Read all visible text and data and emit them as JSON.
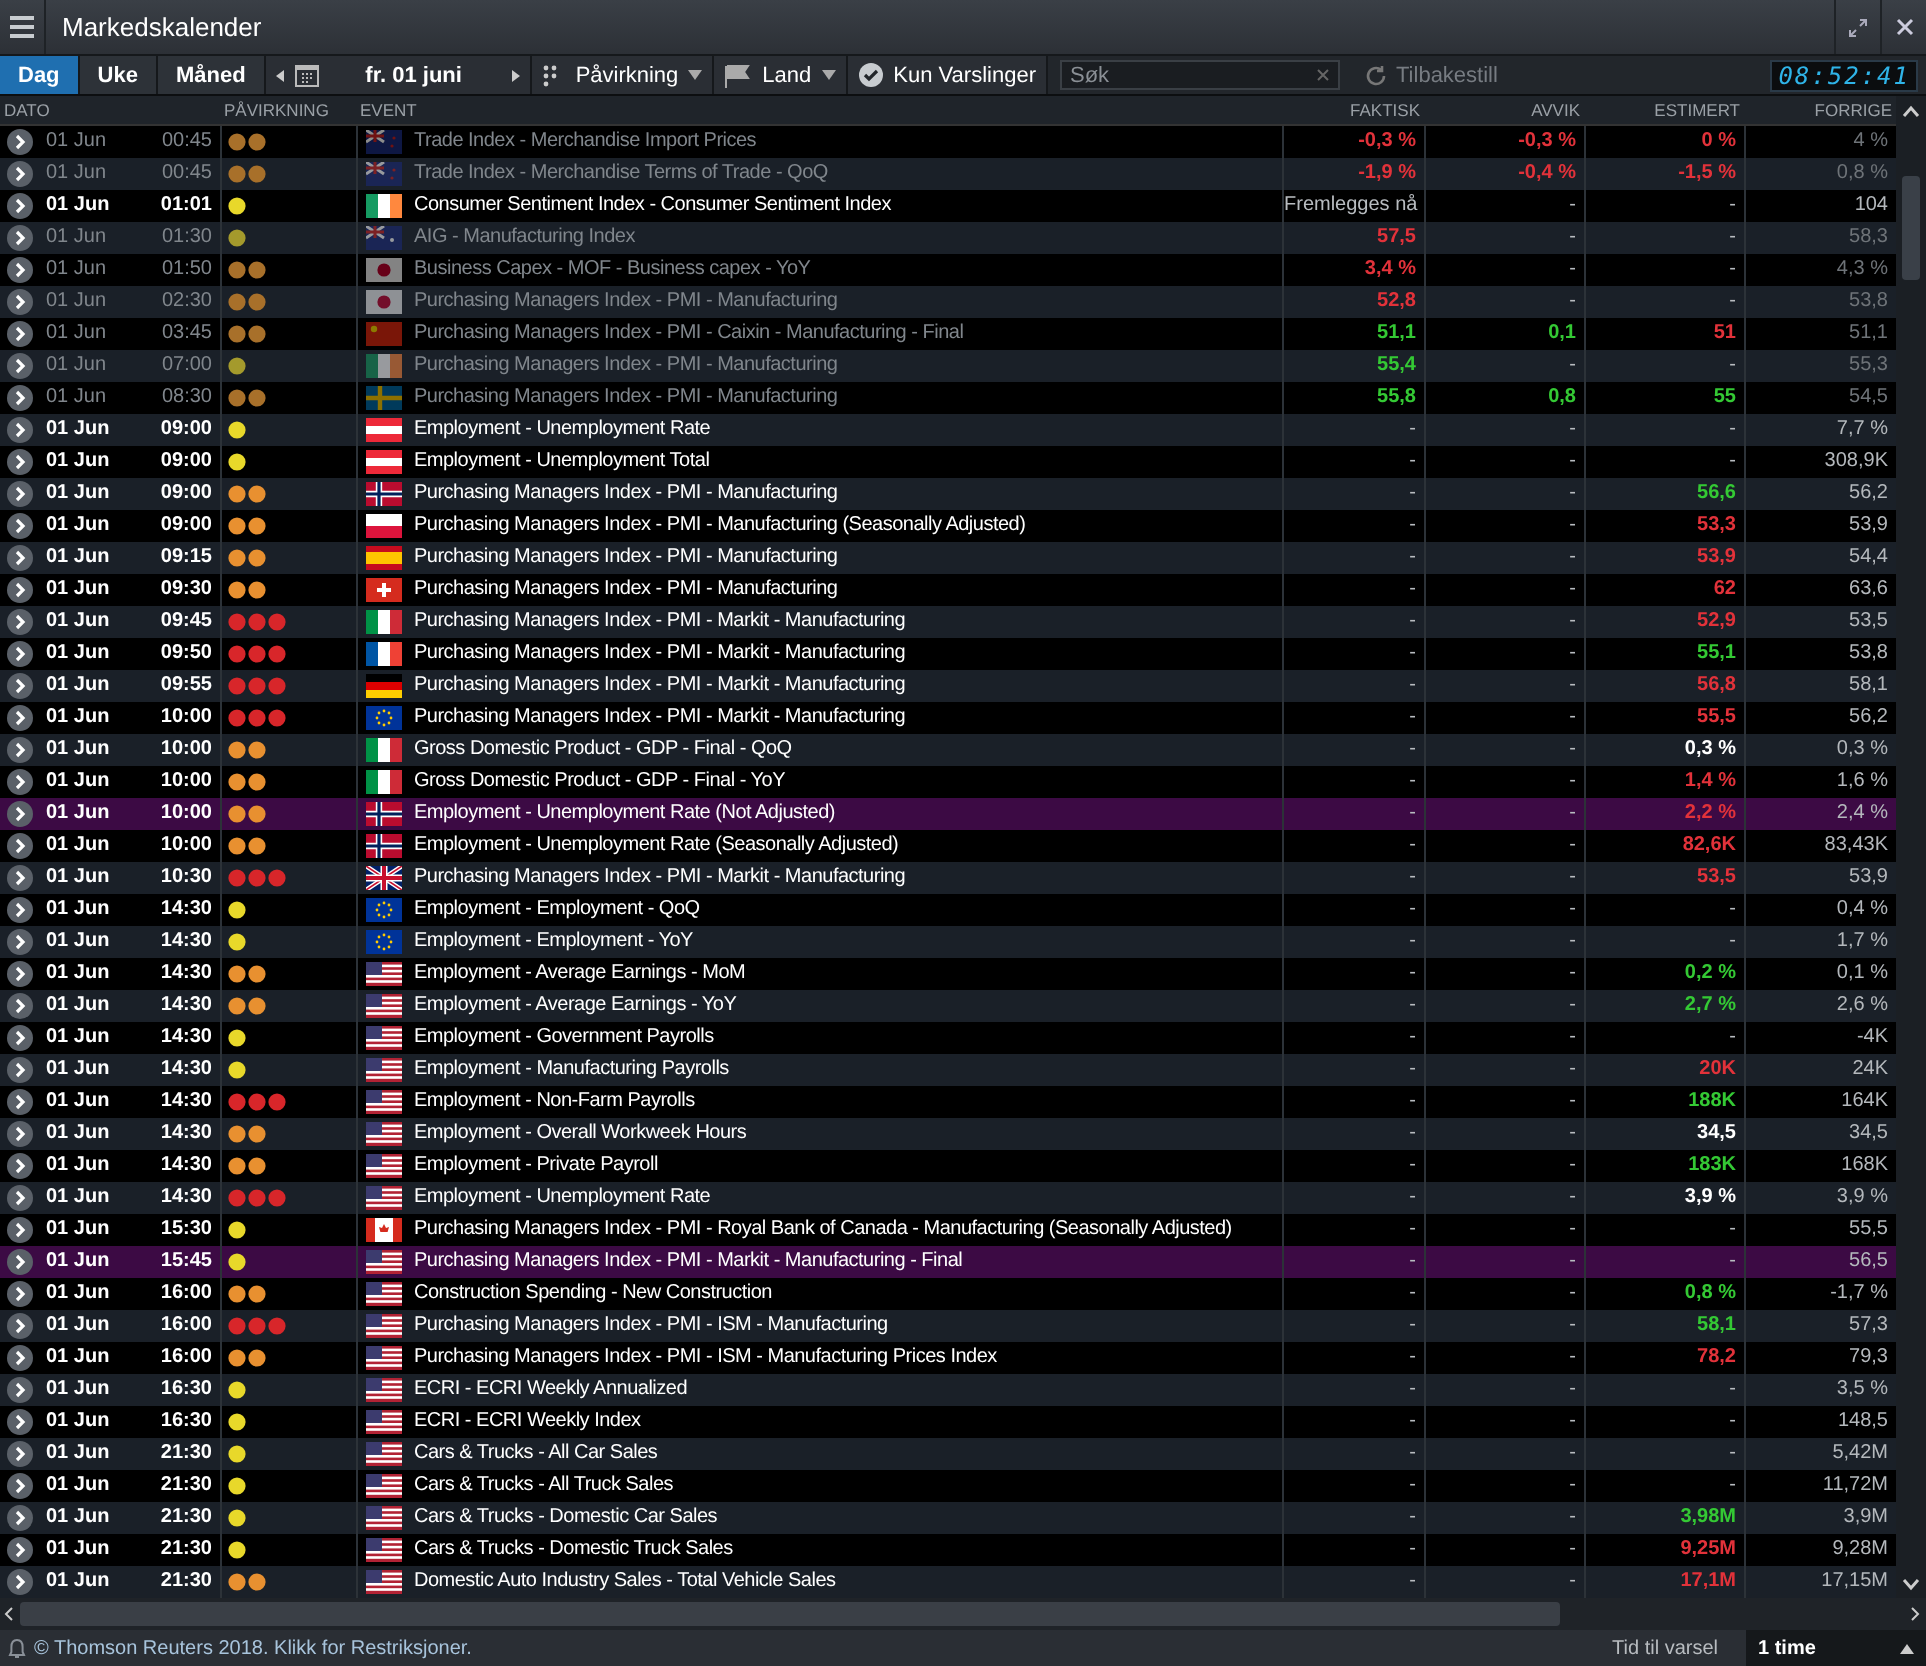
{
  "window": {
    "title": "Markedskalender"
  },
  "toolbar": {
    "tabs": [
      {
        "label": "Dag",
        "selected": true
      },
      {
        "label": "Uke",
        "selected": false
      },
      {
        "label": "Måned",
        "selected": false
      }
    ],
    "date": "fr. 01 juni",
    "filters": [
      {
        "kind": "impact",
        "label": "Påvirkning"
      },
      {
        "kind": "country",
        "label": "Land"
      },
      {
        "kind": "alerts",
        "label": "Kun Varslinger"
      }
    ],
    "search": {
      "placeholder": "Søk"
    },
    "reset": {
      "label": "Tilbakestill",
      "disabled": true
    },
    "clock": "08:52:41"
  },
  "table": {
    "columns": [
      "DATO",
      "PÅVIRKNING",
      "EVENT",
      "FAKTISK",
      "AVVIK",
      "ESTIMERT",
      "FORRIGE"
    ],
    "rows": [
      {
        "date": "01 Jun",
        "time": "00:45",
        "impact": {
          "kind": "medium"
        },
        "flag": {
          "kind": "nz"
        },
        "event": "Trade Index - Merchandise Import Prices",
        "released": true,
        "highlighted": false,
        "actual": {
          "text": "-0,3 %",
          "kind": "negative"
        },
        "deviation": {
          "text": "-0,3 %",
          "kind": "negative"
        },
        "estimate": {
          "text": "0 %",
          "kind": "negative"
        },
        "previous": "4 %"
      },
      {
        "date": "01 Jun",
        "time": "00:45",
        "impact": {
          "kind": "medium"
        },
        "flag": {
          "kind": "nz"
        },
        "event": "Trade Index - Merchandise Terms of Trade - QoQ",
        "released": true,
        "highlighted": false,
        "actual": {
          "text": "-1,9 %",
          "kind": "negative"
        },
        "deviation": {
          "text": "-0,4 %",
          "kind": "negative"
        },
        "estimate": {
          "text": "-1,5 %",
          "kind": "negative"
        },
        "previous": "0,8 %"
      },
      {
        "date": "01 Jun",
        "time": "01:01",
        "impact": {
          "kind": "low"
        },
        "flag": {
          "kind": "ie"
        },
        "event": "Consumer Sentiment Index - Consumer Sentiment Index",
        "released": false,
        "highlighted": false,
        "actual": {
          "text": "Fremlegges nå",
          "kind": "plain"
        },
        "deviation": {
          "text": "-",
          "kind": "plain"
        },
        "estimate": {
          "text": "-",
          "kind": "plain"
        },
        "previous": "104"
      },
      {
        "date": "01 Jun",
        "time": "01:30",
        "impact": {
          "kind": "low"
        },
        "flag": {
          "kind": "au"
        },
        "event": "AIG - Manufacturing Index",
        "released": true,
        "highlighted": false,
        "actual": {
          "text": "57,5",
          "kind": "negative"
        },
        "deviation": {
          "text": "-",
          "kind": "plain"
        },
        "estimate": {
          "text": "-",
          "kind": "plain"
        },
        "previous": "58,3"
      },
      {
        "date": "01 Jun",
        "time": "01:50",
        "impact": {
          "kind": "medium"
        },
        "flag": {
          "kind": "jp"
        },
        "event": "Business Capex - MOF - Business capex - YoY",
        "released": true,
        "highlighted": false,
        "actual": {
          "text": "3,4 %",
          "kind": "negative"
        },
        "deviation": {
          "text": "-",
          "kind": "plain"
        },
        "estimate": {
          "text": "-",
          "kind": "plain"
        },
        "previous": "4,3 %"
      },
      {
        "date": "01 Jun",
        "time": "02:30",
        "impact": {
          "kind": "medium"
        },
        "flag": {
          "kind": "jp"
        },
        "event": "Purchasing Managers Index - PMI - Manufacturing",
        "released": true,
        "highlighted": false,
        "actual": {
          "text": "52,8",
          "kind": "negative"
        },
        "deviation": {
          "text": "-",
          "kind": "plain"
        },
        "estimate": {
          "text": "-",
          "kind": "plain"
        },
        "previous": "53,8"
      },
      {
        "date": "01 Jun",
        "time": "03:45",
        "impact": {
          "kind": "medium"
        },
        "flag": {
          "kind": "cn"
        },
        "event": "Purchasing Managers Index - PMI - Caixin - Manufacturing - Final",
        "released": true,
        "highlighted": false,
        "actual": {
          "text": "51,1",
          "kind": "positive"
        },
        "deviation": {
          "text": "0,1",
          "kind": "positive"
        },
        "estimate": {
          "text": "51",
          "kind": "negative"
        },
        "previous": "51,1"
      },
      {
        "date": "01 Jun",
        "time": "07:00",
        "impact": {
          "kind": "low"
        },
        "flag": {
          "kind": "ie"
        },
        "event": "Purchasing Managers Index - PMI - Manufacturing",
        "released": true,
        "highlighted": false,
        "actual": {
          "text": "55,4",
          "kind": "positive"
        },
        "deviation": {
          "text": "-",
          "kind": "plain"
        },
        "estimate": {
          "text": "-",
          "kind": "plain"
        },
        "previous": "55,3"
      },
      {
        "date": "01 Jun",
        "time": "08:30",
        "impact": {
          "kind": "medium"
        },
        "flag": {
          "kind": "se"
        },
        "event": "Purchasing Managers Index - PMI - Manufacturing",
        "released": true,
        "highlighted": false,
        "actual": {
          "text": "55,8",
          "kind": "positive"
        },
        "deviation": {
          "text": "0,8",
          "kind": "positive"
        },
        "estimate": {
          "text": "55",
          "kind": "positive"
        },
        "previous": "54,5"
      },
      {
        "date": "01 Jun",
        "time": "09:00",
        "impact": {
          "kind": "low"
        },
        "flag": {
          "kind": "at"
        },
        "event": "Employment - Unemployment Rate",
        "released": false,
        "highlighted": false,
        "actual": {
          "text": "-",
          "kind": "plain"
        },
        "deviation": {
          "text": "-",
          "kind": "plain"
        },
        "estimate": {
          "text": "-",
          "kind": "plain"
        },
        "previous": "7,7 %"
      },
      {
        "date": "01 Jun",
        "time": "09:00",
        "impact": {
          "kind": "low"
        },
        "flag": {
          "kind": "at"
        },
        "event": "Employment - Unemployment Total",
        "released": false,
        "highlighted": false,
        "actual": {
          "text": "-",
          "kind": "plain"
        },
        "deviation": {
          "text": "-",
          "kind": "plain"
        },
        "estimate": {
          "text": "-",
          "kind": "plain"
        },
        "previous": "308,9K"
      },
      {
        "date": "01 Jun",
        "time": "09:00",
        "impact": {
          "kind": "medium"
        },
        "flag": {
          "kind": "no"
        },
        "event": "Purchasing Managers Index - PMI - Manufacturing",
        "released": false,
        "highlighted": false,
        "actual": {
          "text": "-",
          "kind": "plain"
        },
        "deviation": {
          "text": "-",
          "kind": "plain"
        },
        "estimate": {
          "text": "56,6",
          "kind": "positive"
        },
        "previous": "56,2"
      },
      {
        "date": "01 Jun",
        "time": "09:00",
        "impact": {
          "kind": "medium"
        },
        "flag": {
          "kind": "pl"
        },
        "event": "Purchasing Managers Index - PMI - Manufacturing (Seasonally Adjusted)",
        "released": false,
        "highlighted": false,
        "actual": {
          "text": "-",
          "kind": "plain"
        },
        "deviation": {
          "text": "-",
          "kind": "plain"
        },
        "estimate": {
          "text": "53,3",
          "kind": "negative"
        },
        "previous": "53,9"
      },
      {
        "date": "01 Jun",
        "time": "09:15",
        "impact": {
          "kind": "medium"
        },
        "flag": {
          "kind": "es"
        },
        "event": "Purchasing Managers Index - PMI - Manufacturing",
        "released": false,
        "highlighted": false,
        "actual": {
          "text": "-",
          "kind": "plain"
        },
        "deviation": {
          "text": "-",
          "kind": "plain"
        },
        "estimate": {
          "text": "53,9",
          "kind": "negative"
        },
        "previous": "54,4"
      },
      {
        "date": "01 Jun",
        "time": "09:30",
        "impact": {
          "kind": "medium"
        },
        "flag": {
          "kind": "ch"
        },
        "event": "Purchasing Managers Index - PMI - Manufacturing",
        "released": false,
        "highlighted": false,
        "actual": {
          "text": "-",
          "kind": "plain"
        },
        "deviation": {
          "text": "-",
          "kind": "plain"
        },
        "estimate": {
          "text": "62",
          "kind": "negative"
        },
        "previous": "63,6"
      },
      {
        "date": "01 Jun",
        "time": "09:45",
        "impact": {
          "kind": "high"
        },
        "flag": {
          "kind": "it"
        },
        "event": "Purchasing Managers Index - PMI - Markit - Manufacturing",
        "released": false,
        "highlighted": false,
        "actual": {
          "text": "-",
          "kind": "plain"
        },
        "deviation": {
          "text": "-",
          "kind": "plain"
        },
        "estimate": {
          "text": "52,9",
          "kind": "negative"
        },
        "previous": "53,5"
      },
      {
        "date": "01 Jun",
        "time": "09:50",
        "impact": {
          "kind": "high"
        },
        "flag": {
          "kind": "fr"
        },
        "event": "Purchasing Managers Index - PMI - Markit - Manufacturing",
        "released": false,
        "highlighted": false,
        "actual": {
          "text": "-",
          "kind": "plain"
        },
        "deviation": {
          "text": "-",
          "kind": "plain"
        },
        "estimate": {
          "text": "55,1",
          "kind": "positive"
        },
        "previous": "53,8"
      },
      {
        "date": "01 Jun",
        "time": "09:55",
        "impact": {
          "kind": "high"
        },
        "flag": {
          "kind": "de"
        },
        "event": "Purchasing Managers Index - PMI - Markit - Manufacturing",
        "released": false,
        "highlighted": false,
        "actual": {
          "text": "-",
          "kind": "plain"
        },
        "deviation": {
          "text": "-",
          "kind": "plain"
        },
        "estimate": {
          "text": "56,8",
          "kind": "negative"
        },
        "previous": "58,1"
      },
      {
        "date": "01 Jun",
        "time": "10:00",
        "impact": {
          "kind": "high"
        },
        "flag": {
          "kind": "eu"
        },
        "event": "Purchasing Managers Index - PMI - Markit - Manufacturing",
        "released": false,
        "highlighted": false,
        "actual": {
          "text": "-",
          "kind": "plain"
        },
        "deviation": {
          "text": "-",
          "kind": "plain"
        },
        "estimate": {
          "text": "55,5",
          "kind": "negative"
        },
        "previous": "56,2"
      },
      {
        "date": "01 Jun",
        "time": "10:00",
        "impact": {
          "kind": "medium"
        },
        "flag": {
          "kind": "it"
        },
        "event": "Gross Domestic Product - GDP - Final - QoQ",
        "released": false,
        "highlighted": false,
        "actual": {
          "text": "-",
          "kind": "plain"
        },
        "deviation": {
          "text": "-",
          "kind": "plain"
        },
        "estimate": {
          "text": "0,3 %",
          "kind": "neutral"
        },
        "previous": "0,3 %"
      },
      {
        "date": "01 Jun",
        "time": "10:00",
        "impact": {
          "kind": "medium"
        },
        "flag": {
          "kind": "it"
        },
        "event": "Gross Domestic Product - GDP - Final - YoY",
        "released": false,
        "highlighted": false,
        "actual": {
          "text": "-",
          "kind": "plain"
        },
        "deviation": {
          "text": "-",
          "kind": "plain"
        },
        "estimate": {
          "text": "1,4 %",
          "kind": "negative"
        },
        "previous": "1,6 %"
      },
      {
        "date": "01 Jun",
        "time": "10:00",
        "impact": {
          "kind": "medium"
        },
        "flag": {
          "kind": "no"
        },
        "event": "Employment - Unemployment Rate (Not Adjusted)",
        "released": false,
        "highlighted": true,
        "actual": {
          "text": "-",
          "kind": "plain"
        },
        "deviation": {
          "text": "-",
          "kind": "plain"
        },
        "estimate": {
          "text": "2,2 %",
          "kind": "negative"
        },
        "previous": "2,4 %"
      },
      {
        "date": "01 Jun",
        "time": "10:00",
        "impact": {
          "kind": "medium"
        },
        "flag": {
          "kind": "no"
        },
        "event": "Employment - Unemployment Rate (Seasonally Adjusted)",
        "released": false,
        "highlighted": false,
        "actual": {
          "text": "-",
          "kind": "plain"
        },
        "deviation": {
          "text": "-",
          "kind": "plain"
        },
        "estimate": {
          "text": "82,6K",
          "kind": "negative"
        },
        "previous": "83,43K"
      },
      {
        "date": "01 Jun",
        "time": "10:30",
        "impact": {
          "kind": "high"
        },
        "flag": {
          "kind": "gb"
        },
        "event": "Purchasing Managers Index - PMI - Markit - Manufacturing",
        "released": false,
        "highlighted": false,
        "actual": {
          "text": "-",
          "kind": "plain"
        },
        "deviation": {
          "text": "-",
          "kind": "plain"
        },
        "estimate": {
          "text": "53,5",
          "kind": "negative"
        },
        "previous": "53,9"
      },
      {
        "date": "01 Jun",
        "time": "14:30",
        "impact": {
          "kind": "low"
        },
        "flag": {
          "kind": "eu"
        },
        "event": "Employment - Employment - QoQ",
        "released": false,
        "highlighted": false,
        "actual": {
          "text": "-",
          "kind": "plain"
        },
        "deviation": {
          "text": "-",
          "kind": "plain"
        },
        "estimate": {
          "text": "-",
          "kind": "plain"
        },
        "previous": "0,4 %"
      },
      {
        "date": "01 Jun",
        "time": "14:30",
        "impact": {
          "kind": "low"
        },
        "flag": {
          "kind": "eu"
        },
        "event": "Employment - Employment - YoY",
        "released": false,
        "highlighted": false,
        "actual": {
          "text": "-",
          "kind": "plain"
        },
        "deviation": {
          "text": "-",
          "kind": "plain"
        },
        "estimate": {
          "text": "-",
          "kind": "plain"
        },
        "previous": "1,7 %"
      },
      {
        "date": "01 Jun",
        "time": "14:30",
        "impact": {
          "kind": "medium"
        },
        "flag": {
          "kind": "us"
        },
        "event": "Employment - Average Earnings - MoM",
        "released": false,
        "highlighted": false,
        "actual": {
          "text": "-",
          "kind": "plain"
        },
        "deviation": {
          "text": "-",
          "kind": "plain"
        },
        "estimate": {
          "text": "0,2 %",
          "kind": "positive"
        },
        "previous": "0,1 %"
      },
      {
        "date": "01 Jun",
        "time": "14:30",
        "impact": {
          "kind": "medium"
        },
        "flag": {
          "kind": "us"
        },
        "event": "Employment - Average Earnings - YoY",
        "released": false,
        "highlighted": false,
        "actual": {
          "text": "-",
          "kind": "plain"
        },
        "deviation": {
          "text": "-",
          "kind": "plain"
        },
        "estimate": {
          "text": "2,7 %",
          "kind": "positive"
        },
        "previous": "2,6 %"
      },
      {
        "date": "01 Jun",
        "time": "14:30",
        "impact": {
          "kind": "low"
        },
        "flag": {
          "kind": "us"
        },
        "event": "Employment - Government Payrolls",
        "released": false,
        "highlighted": false,
        "actual": {
          "text": "-",
          "kind": "plain"
        },
        "deviation": {
          "text": "-",
          "kind": "plain"
        },
        "estimate": {
          "text": "-",
          "kind": "plain"
        },
        "previous": "-4K"
      },
      {
        "date": "01 Jun",
        "time": "14:30",
        "impact": {
          "kind": "low"
        },
        "flag": {
          "kind": "us"
        },
        "event": "Employment - Manufacturing Payrolls",
        "released": false,
        "highlighted": false,
        "actual": {
          "text": "-",
          "kind": "plain"
        },
        "deviation": {
          "text": "-",
          "kind": "plain"
        },
        "estimate": {
          "text": "20K",
          "kind": "negative"
        },
        "previous": "24K"
      },
      {
        "date": "01 Jun",
        "time": "14:30",
        "impact": {
          "kind": "high"
        },
        "flag": {
          "kind": "us"
        },
        "event": "Employment - Non-Farm Payrolls",
        "released": false,
        "highlighted": false,
        "actual": {
          "text": "-",
          "kind": "plain"
        },
        "deviation": {
          "text": "-",
          "kind": "plain"
        },
        "estimate": {
          "text": "188K",
          "kind": "positive"
        },
        "previous": "164K"
      },
      {
        "date": "01 Jun",
        "time": "14:30",
        "impact": {
          "kind": "medium"
        },
        "flag": {
          "kind": "us"
        },
        "event": "Employment - Overall Workweek Hours",
        "released": false,
        "highlighted": false,
        "actual": {
          "text": "-",
          "kind": "plain"
        },
        "deviation": {
          "text": "-",
          "kind": "plain"
        },
        "estimate": {
          "text": "34,5",
          "kind": "neutral"
        },
        "previous": "34,5"
      },
      {
        "date": "01 Jun",
        "time": "14:30",
        "impact": {
          "kind": "medium"
        },
        "flag": {
          "kind": "us"
        },
        "event": "Employment - Private Payroll",
        "released": false,
        "highlighted": false,
        "actual": {
          "text": "-",
          "kind": "plain"
        },
        "deviation": {
          "text": "-",
          "kind": "plain"
        },
        "estimate": {
          "text": "183K",
          "kind": "positive"
        },
        "previous": "168K"
      },
      {
        "date": "01 Jun",
        "time": "14:30",
        "impact": {
          "kind": "high"
        },
        "flag": {
          "kind": "us"
        },
        "event": "Employment - Unemployment Rate",
        "released": false,
        "highlighted": false,
        "actual": {
          "text": "-",
          "kind": "plain"
        },
        "deviation": {
          "text": "-",
          "kind": "plain"
        },
        "estimate": {
          "text": "3,9 %",
          "kind": "neutral"
        },
        "previous": "3,9 %"
      },
      {
        "date": "01 Jun",
        "time": "15:30",
        "impact": {
          "kind": "low"
        },
        "flag": {
          "kind": "ca"
        },
        "event": "Purchasing Managers Index - PMI - Royal Bank of Canada - Manufacturing (Seasonally Adjusted)",
        "released": false,
        "highlighted": false,
        "actual": {
          "text": "-",
          "kind": "plain"
        },
        "deviation": {
          "text": "-",
          "kind": "plain"
        },
        "estimate": {
          "text": "-",
          "kind": "plain"
        },
        "previous": "55,5"
      },
      {
        "date": "01 Jun",
        "time": "15:45",
        "impact": {
          "kind": "low"
        },
        "flag": {
          "kind": "us"
        },
        "event": "Purchasing Managers Index - PMI - Markit - Manufacturing - Final",
        "released": false,
        "highlighted": true,
        "actual": {
          "text": "-",
          "kind": "plain"
        },
        "deviation": {
          "text": "-",
          "kind": "plain"
        },
        "estimate": {
          "text": "-",
          "kind": "plain"
        },
        "previous": "56,5"
      },
      {
        "date": "01 Jun",
        "time": "16:00",
        "impact": {
          "kind": "medium"
        },
        "flag": {
          "kind": "us"
        },
        "event": "Construction Spending - New Construction",
        "released": false,
        "highlighted": false,
        "actual": {
          "text": "-",
          "kind": "plain"
        },
        "deviation": {
          "text": "-",
          "kind": "plain"
        },
        "estimate": {
          "text": "0,8 %",
          "kind": "positive"
        },
        "previous": "-1,7 %"
      },
      {
        "date": "01 Jun",
        "time": "16:00",
        "impact": {
          "kind": "high"
        },
        "flag": {
          "kind": "us"
        },
        "event": "Purchasing Managers Index - PMI - ISM - Manufacturing",
        "released": false,
        "highlighted": false,
        "actual": {
          "text": "-",
          "kind": "plain"
        },
        "deviation": {
          "text": "-",
          "kind": "plain"
        },
        "estimate": {
          "text": "58,1",
          "kind": "positive"
        },
        "previous": "57,3"
      },
      {
        "date": "01 Jun",
        "time": "16:00",
        "impact": {
          "kind": "medium"
        },
        "flag": {
          "kind": "us"
        },
        "event": "Purchasing Managers Index - PMI - ISM - Manufacturing Prices Index",
        "released": false,
        "highlighted": false,
        "actual": {
          "text": "-",
          "kind": "plain"
        },
        "deviation": {
          "text": "-",
          "kind": "plain"
        },
        "estimate": {
          "text": "78,2",
          "kind": "negative"
        },
        "previous": "79,3"
      },
      {
        "date": "01 Jun",
        "time": "16:30",
        "impact": {
          "kind": "low"
        },
        "flag": {
          "kind": "us"
        },
        "event": "ECRI - ECRI Weekly Annualized",
        "released": false,
        "highlighted": false,
        "actual": {
          "text": "-",
          "kind": "plain"
        },
        "deviation": {
          "text": "-",
          "kind": "plain"
        },
        "estimate": {
          "text": "-",
          "kind": "plain"
        },
        "previous": "3,5 %"
      },
      {
        "date": "01 Jun",
        "time": "16:30",
        "impact": {
          "kind": "low"
        },
        "flag": {
          "kind": "us"
        },
        "event": "ECRI - ECRI Weekly Index",
        "released": false,
        "highlighted": false,
        "actual": {
          "text": "-",
          "kind": "plain"
        },
        "deviation": {
          "text": "-",
          "kind": "plain"
        },
        "estimate": {
          "text": "-",
          "kind": "plain"
        },
        "previous": "148,5"
      },
      {
        "date": "01 Jun",
        "time": "21:30",
        "impact": {
          "kind": "low"
        },
        "flag": {
          "kind": "us"
        },
        "event": "Cars & Trucks - All Car Sales",
        "released": false,
        "highlighted": false,
        "actual": {
          "text": "-",
          "kind": "plain"
        },
        "deviation": {
          "text": "-",
          "kind": "plain"
        },
        "estimate": {
          "text": "-",
          "kind": "plain"
        },
        "previous": "5,42M"
      },
      {
        "date": "01 Jun",
        "time": "21:30",
        "impact": {
          "kind": "low"
        },
        "flag": {
          "kind": "us"
        },
        "event": "Cars & Trucks - All Truck Sales",
        "released": false,
        "highlighted": false,
        "actual": {
          "text": "-",
          "kind": "plain"
        },
        "deviation": {
          "text": "-",
          "kind": "plain"
        },
        "estimate": {
          "text": "-",
          "kind": "plain"
        },
        "previous": "11,72M"
      },
      {
        "date": "01 Jun",
        "time": "21:30",
        "impact": {
          "kind": "low"
        },
        "flag": {
          "kind": "us"
        },
        "event": "Cars & Trucks - Domestic Car Sales",
        "released": false,
        "highlighted": false,
        "actual": {
          "text": "-",
          "kind": "plain"
        },
        "deviation": {
          "text": "-",
          "kind": "plain"
        },
        "estimate": {
          "text": "3,98M",
          "kind": "positive"
        },
        "previous": "3,9M"
      },
      {
        "date": "01 Jun",
        "time": "21:30",
        "impact": {
          "kind": "low"
        },
        "flag": {
          "kind": "us"
        },
        "event": "Cars & Trucks - Domestic Truck Sales",
        "released": false,
        "highlighted": false,
        "actual": {
          "text": "-",
          "kind": "plain"
        },
        "deviation": {
          "text": "-",
          "kind": "plain"
        },
        "estimate": {
          "text": "9,25M",
          "kind": "negative"
        },
        "previous": "9,28M"
      },
      {
        "date": "01 Jun",
        "time": "21:30",
        "impact": {
          "kind": "medium"
        },
        "flag": {
          "kind": "us"
        },
        "event": "Domestic Auto Industry Sales - Total Vehicle Sales",
        "released": false,
        "highlighted": false,
        "actual": {
          "text": "-",
          "kind": "plain"
        },
        "deviation": {
          "text": "-",
          "kind": "plain"
        },
        "estimate": {
          "text": "17,1M",
          "kind": "negative"
        },
        "previous": "17,15M"
      }
    ]
  },
  "status_bar": {
    "copyright": "© Thomson Reuters 2018. Klikk for Restriksjoner.",
    "alert_label": "Tid til varsel",
    "alert_value": "1 time"
  }
}
